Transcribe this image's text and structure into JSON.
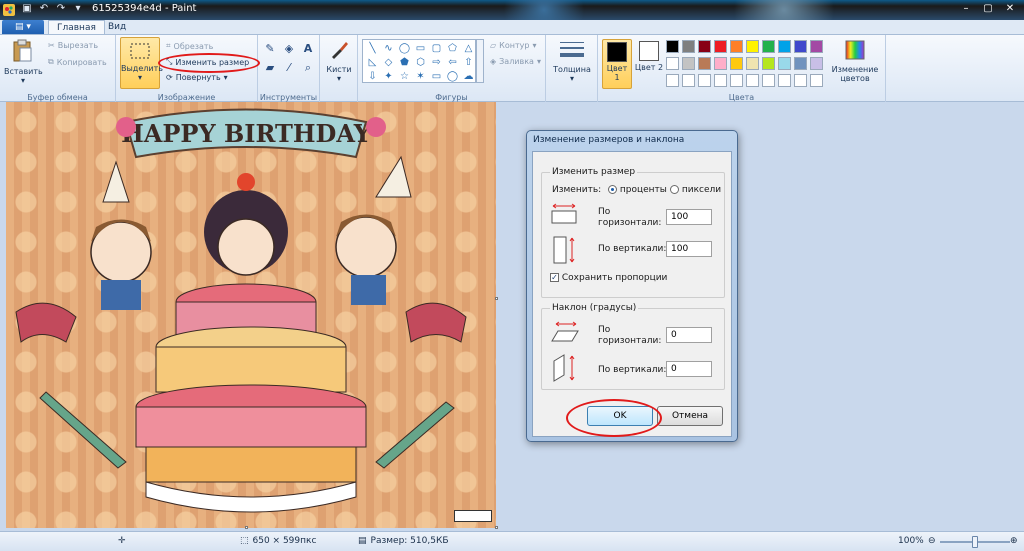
{
  "window": {
    "title": "61525394e4d - Paint",
    "controls": [
      "–",
      "▢",
      "✕"
    ]
  },
  "quick_access": [
    "save-icon",
    "undo-icon",
    "redo-icon",
    "customize-icon"
  ],
  "tabs": {
    "file": "▤ ▾",
    "home": "Главная",
    "view": "Вид"
  },
  "ribbon": {
    "clipboard": {
      "label": "Буфер обмена",
      "paste": "Вставить",
      "cut": "Вырезать",
      "copy": "Копировать"
    },
    "image": {
      "label": "Изображение",
      "select": "Выделить",
      "crop": "Обрезать",
      "resize": "Изменить размер",
      "rotate": "Повернуть"
    },
    "tools": {
      "label": "Инструменты",
      "icons": [
        "pencil-icon",
        "fill-icon",
        "text-icon",
        "eraser-icon",
        "color-picker-icon",
        "magnifier-icon"
      ]
    },
    "brushes": "Кисти",
    "shapes": {
      "label": "Фигуры",
      "outline": "Контур",
      "fill": "Заливка"
    },
    "size": "Толщина",
    "colors": {
      "label": "Цвета",
      "color1": "Цвет 1",
      "color2": "Цвет 2",
      "edit": "Изменение цветов",
      "color1_value": "#000000",
      "color2_value": "#ffffff",
      "palette": [
        "#000000",
        "#7f7f7f",
        "#880015",
        "#ed1c24",
        "#ff7f27",
        "#fff200",
        "#22b14c",
        "#00a2e8",
        "#3f48cc",
        "#a349a4",
        "#ffffff",
        "#c3c3c3",
        "#b97a57",
        "#ffaec9",
        "#ffc90e",
        "#efe4b0",
        "#b5e61d",
        "#99d9ea",
        "#7092be",
        "#c8bfe7",
        "#ffffff",
        "#ffffff",
        "#ffffff",
        "#ffffff",
        "#ffffff",
        "#ffffff",
        "#ffffff",
        "#ffffff",
        "#ffffff",
        "#ffffff"
      ]
    }
  },
  "canvas_image": {
    "banner_text": "HAPPY BIRTHDAY"
  },
  "dialog": {
    "title": "Изменение размеров и наклона",
    "resize_group": "Изменить размер",
    "by_label": "Изменить:",
    "option_percent": "проценты",
    "option_pixels": "пиксели",
    "horizontal_label": "По горизонтали:",
    "vertical_label": "По вертикали:",
    "resize_h": "100",
    "resize_v": "100",
    "keep_ratio": "Сохранить пропорции",
    "keep_ratio_checked": true,
    "skew_group": "Наклон (градусы)",
    "skew_h": "0",
    "skew_v": "0",
    "ok": "OK",
    "cancel": "Отмена"
  },
  "status": {
    "dimensions": "650 × 599пкс",
    "size": "Размер: 510,5КБ",
    "zoom": "100%"
  }
}
